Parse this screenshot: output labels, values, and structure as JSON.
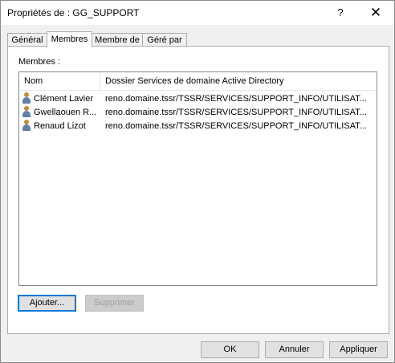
{
  "window": {
    "title": "Propriétés de : GG_SUPPORT",
    "help_glyph": "?",
    "close_glyph": "✕"
  },
  "tabs": [
    {
      "label": "Général",
      "active": false
    },
    {
      "label": "Membres",
      "active": true
    },
    {
      "label": "Membre de",
      "active": false
    },
    {
      "label": "Géré par",
      "active": false
    }
  ],
  "members_section": {
    "label": "Membres :",
    "columns": [
      "Nom",
      "Dossier Services de domaine Active Directory"
    ],
    "rows": [
      {
        "name": "Clément Lavier",
        "path": "reno.domaine.tssr/TSSR/SERVICES/SUPPORT_INFO/UTILISAT...",
        "icon": "user-icon"
      },
      {
        "name": "Gwellaouen R...",
        "path": "reno.domaine.tssr/TSSR/SERVICES/SUPPORT_INFO/UTILISAT...",
        "icon": "user-icon"
      },
      {
        "name": "Renaud Lizot",
        "path": "reno.domaine.tssr/TSSR/SERVICES/SUPPORT_INFO/UTILISAT...",
        "icon": "user-icon"
      }
    ],
    "add_label": "Ajouter...",
    "remove_label": "Supprimer"
  },
  "footer": {
    "ok_label": "OK",
    "cancel_label": "Annuler",
    "apply_label": "Appliquer"
  },
  "colors": {
    "accent": "#0078d7",
    "background": "#f0f0f0"
  }
}
